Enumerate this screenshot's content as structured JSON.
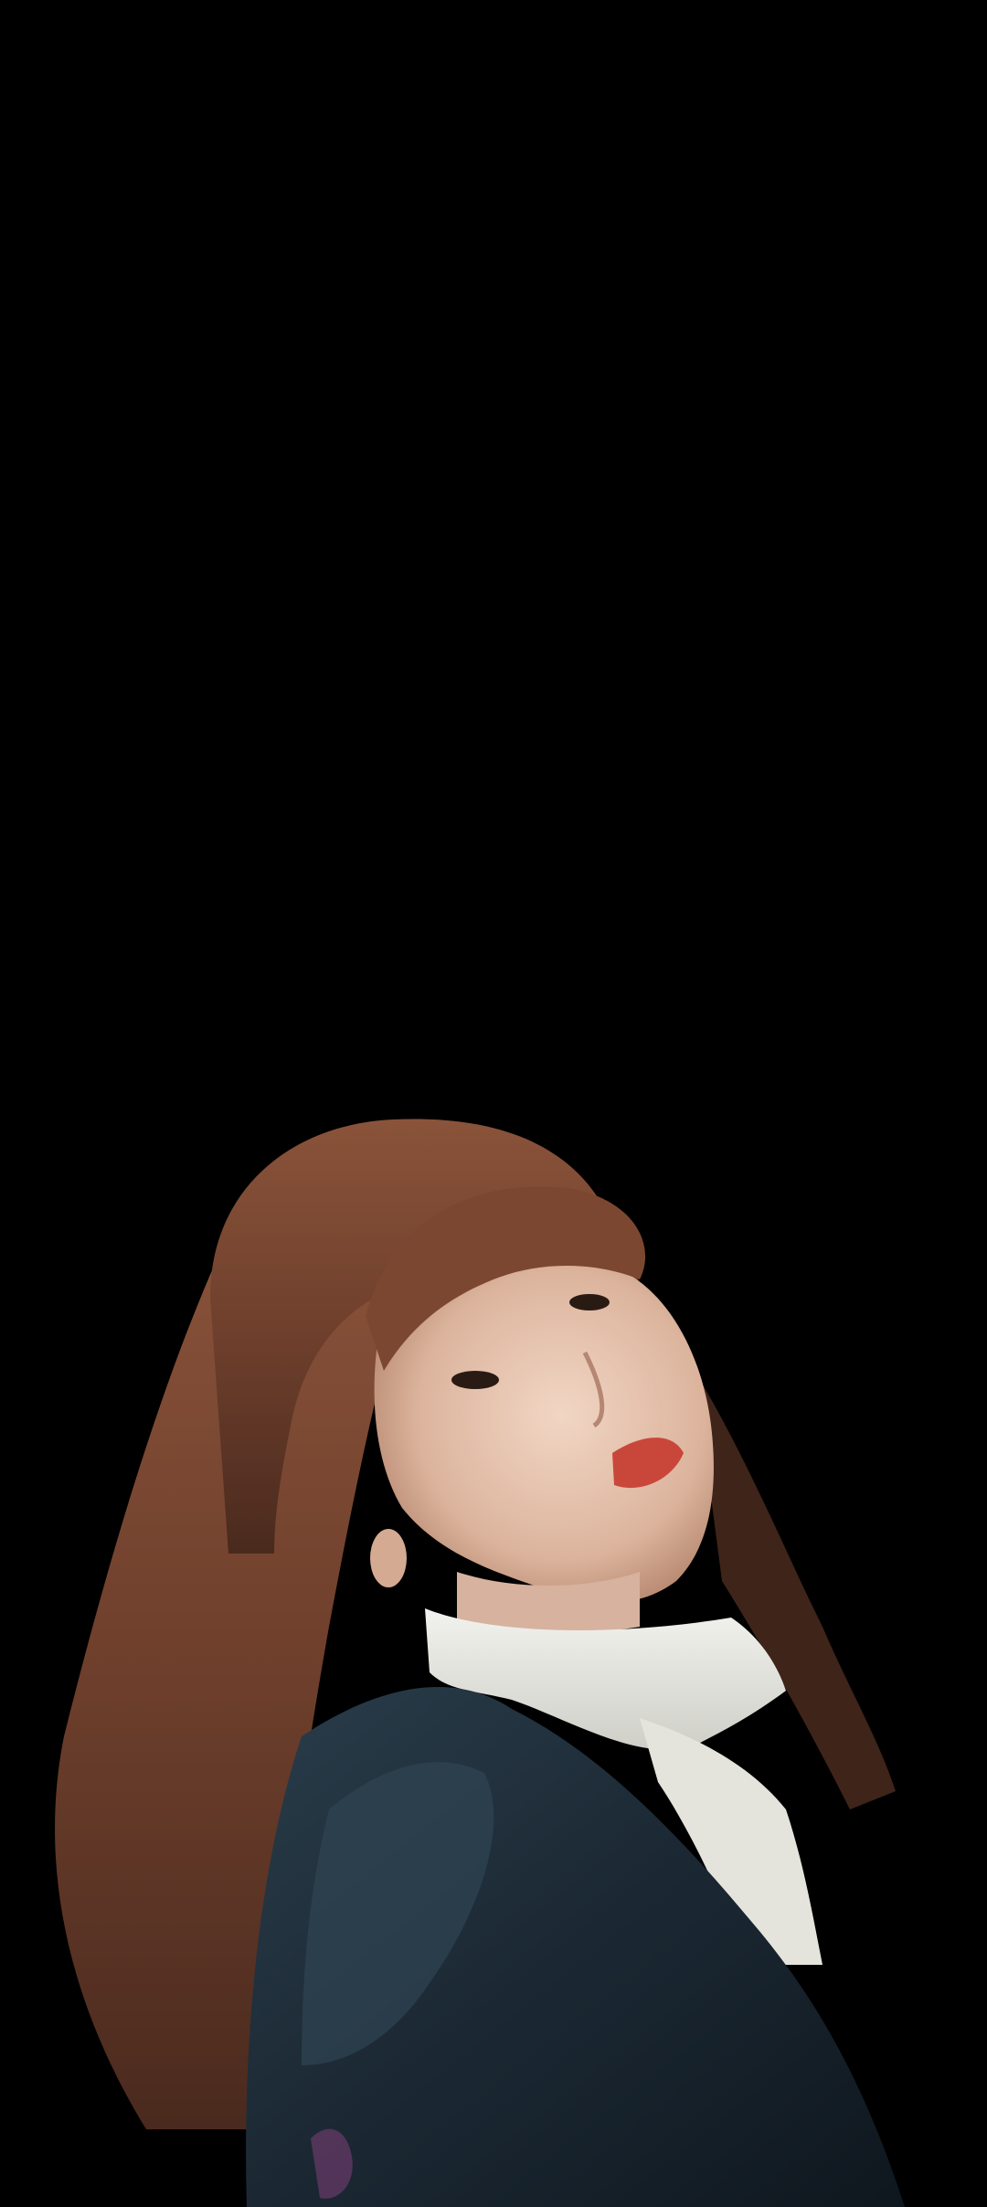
{
  "wallpaper": {
    "background_color": "#000000",
    "subject": "portrait photo",
    "palette": {
      "hair": "#7a4a34",
      "skin": "#e8c9b6",
      "lips": "#c9473a",
      "collar": "#e9e9e4",
      "jacket": "#1c2a36"
    }
  }
}
